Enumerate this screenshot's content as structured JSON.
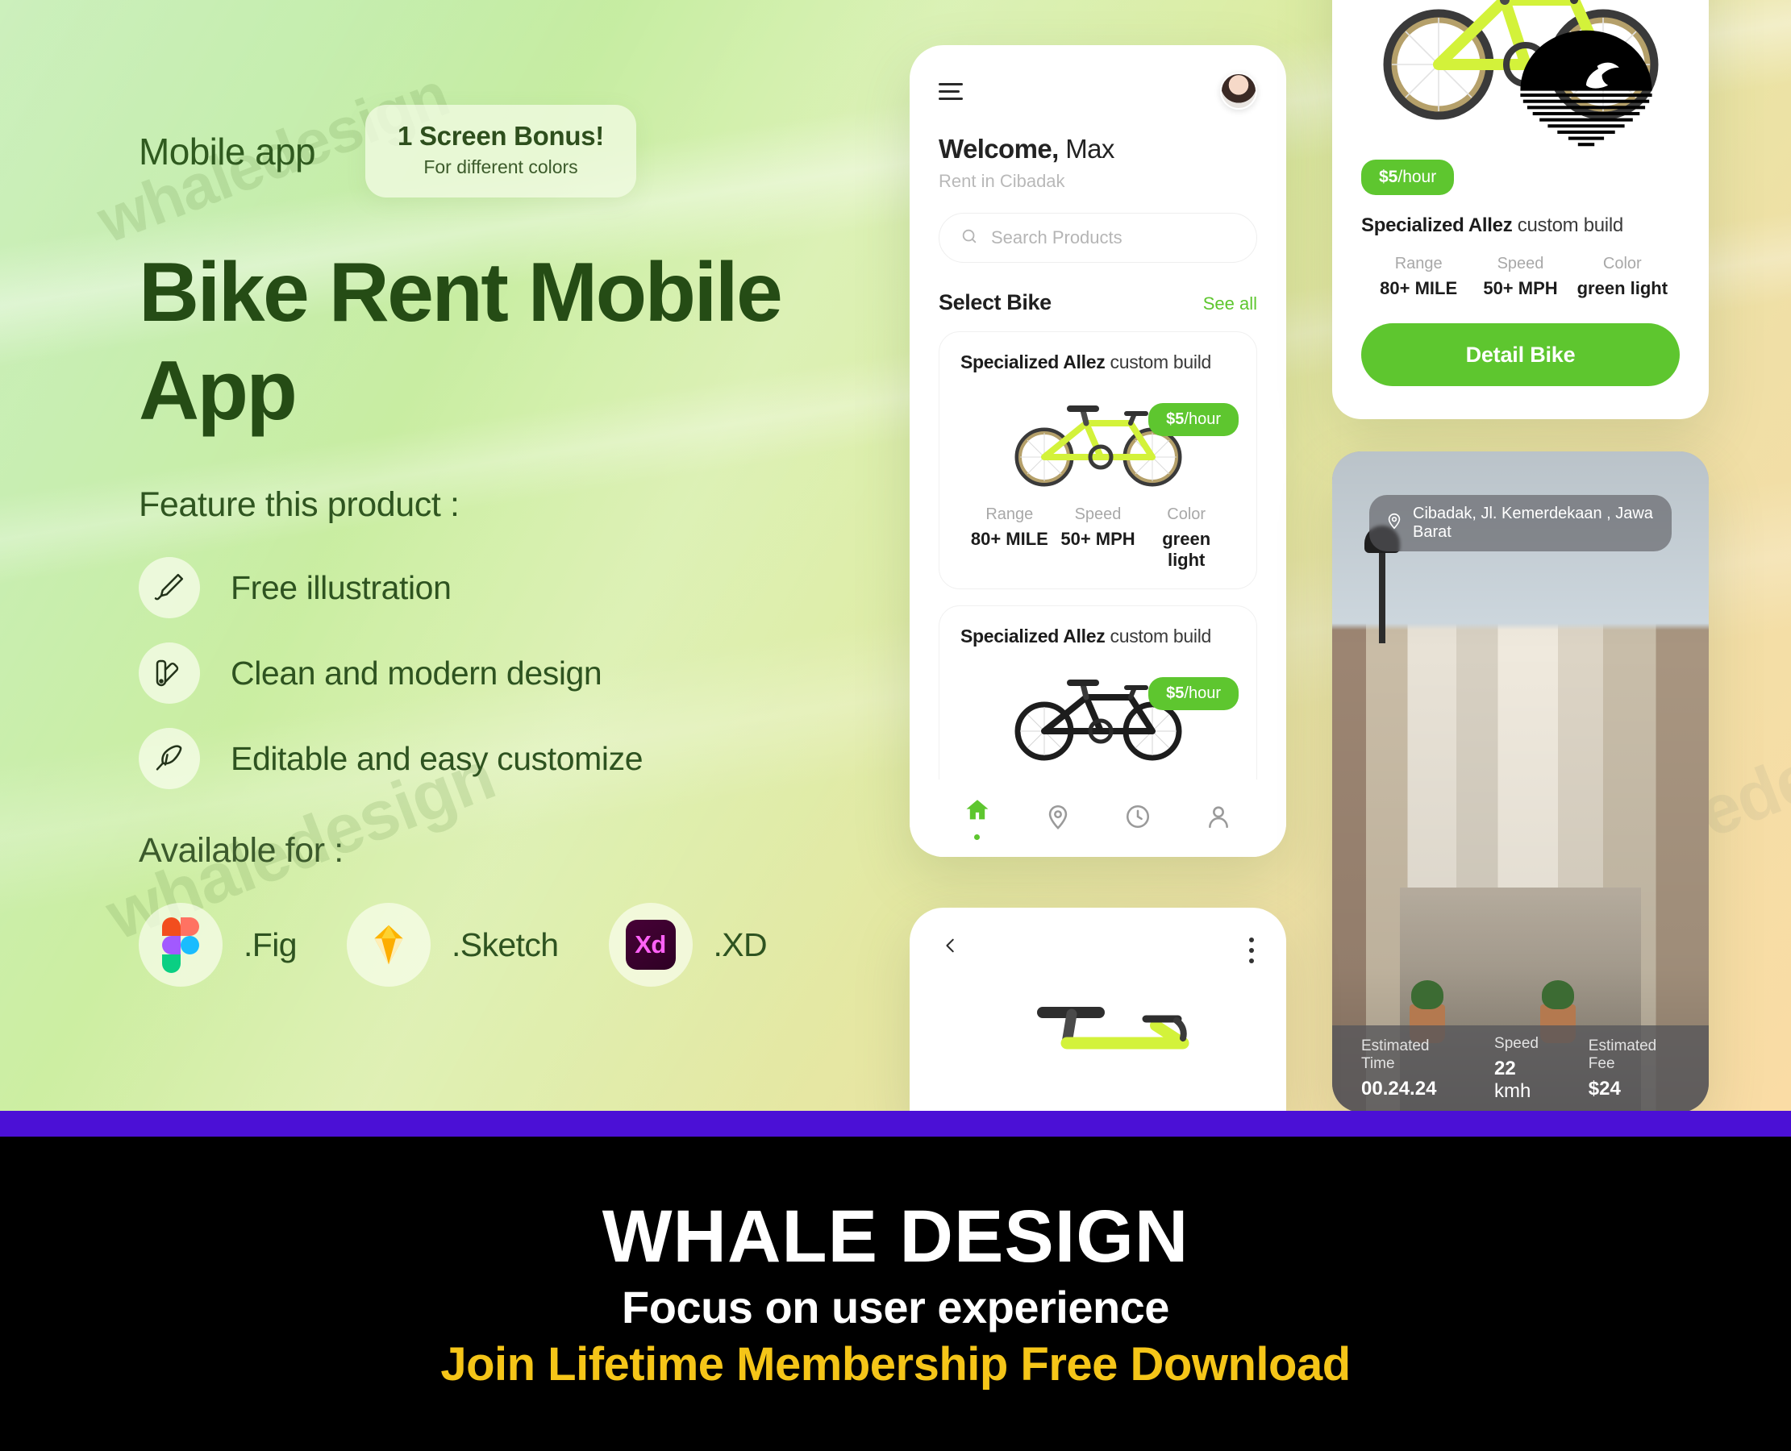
{
  "brand": {
    "accent_green": "#5ec62f",
    "headline_green": "#254c15",
    "purple_bar": "#4b10d6",
    "cta_yellow": "#f5c518",
    "watermark_text": "whaledesign",
    "logo_name": "whale-logo"
  },
  "hero": {
    "kicker": "Mobile app",
    "bonus_badge": {
      "title": "1 Screen Bonus!",
      "subtitle": "For different colors"
    },
    "headline": "Bike Rent Mobile App",
    "feature_heading": "Feature this product :",
    "features": [
      {
        "icon": "paint-brush-icon",
        "label": "Free illustration"
      },
      {
        "icon": "color-swatch-icon",
        "label": "Clean and modern design"
      },
      {
        "icon": "feather-icon",
        "label": "Editable and easy customize"
      }
    ],
    "available_heading": "Available for :",
    "formats": [
      {
        "icon": "figma-icon",
        "label": ".Fig"
      },
      {
        "icon": "sketch-icon",
        "label": ".Sketch"
      },
      {
        "icon": "adobe-xd-icon",
        "label": ".XD"
      }
    ]
  },
  "phone_home": {
    "menu_icon": "hamburger-icon",
    "avatar": "user-avatar",
    "welcome_bold": "Welcome,",
    "welcome_name": " Max",
    "location_line": "Rent in Cibadak",
    "search": {
      "icon": "search-icon",
      "placeholder": "Search Products",
      "value": ""
    },
    "section_title": "Select Bike",
    "see_all": "See all",
    "spec_labels": {
      "range": "Range",
      "speed": "Speed",
      "color": "Color"
    },
    "cards": [
      {
        "title_bold": "Specialized Allez",
        "title_rest": " custom build",
        "price": "$5",
        "price_unit": "/hour",
        "range": "80+ MILE",
        "speed": "50+ MPH",
        "color": "green light",
        "bike_color": "#d3f23a"
      },
      {
        "title_bold": "Specialized Allez",
        "title_rest": " custom build",
        "price": "$5",
        "price_unit": "/hour",
        "range": "",
        "speed": "",
        "color": "",
        "bike_color": "#1d1d1d"
      }
    ],
    "tabs": [
      {
        "icon": "home-icon",
        "active": true
      },
      {
        "icon": "location-pin-icon",
        "active": false
      },
      {
        "icon": "clock-icon",
        "active": false
      },
      {
        "icon": "person-icon",
        "active": false
      }
    ]
  },
  "phone_detail": {
    "price": "$5",
    "price_unit": "/hour",
    "title_bold": "Specialized Allez",
    "title_rest": " custom build",
    "spec_labels": {
      "range": "Range",
      "speed": "Speed",
      "color": "Color"
    },
    "range": "80+ MILE",
    "speed": "50+ MPH",
    "color": "green light",
    "cta": "Detail Bike"
  },
  "phone_map": {
    "location_icon": "location-pin-icon",
    "location": "Cibadak, Jl. Kemerdekaan , Jawa Barat",
    "stats": [
      {
        "label": "Estimated Time",
        "value": "00.24.24",
        "unit": ""
      },
      {
        "label": "Speed",
        "value": "22",
        "unit": " kmh"
      },
      {
        "label": "Estimated Fee",
        "value": "$24",
        "unit": ""
      }
    ]
  },
  "phone_peek": {
    "back_icon": "chevron-left-icon",
    "menu_icon": "kebab-menu-icon"
  },
  "footer": {
    "brand": "WHALE DESIGN",
    "tagline": "Focus on user experience",
    "cta": "Join Lifetime Membership Free Download"
  }
}
